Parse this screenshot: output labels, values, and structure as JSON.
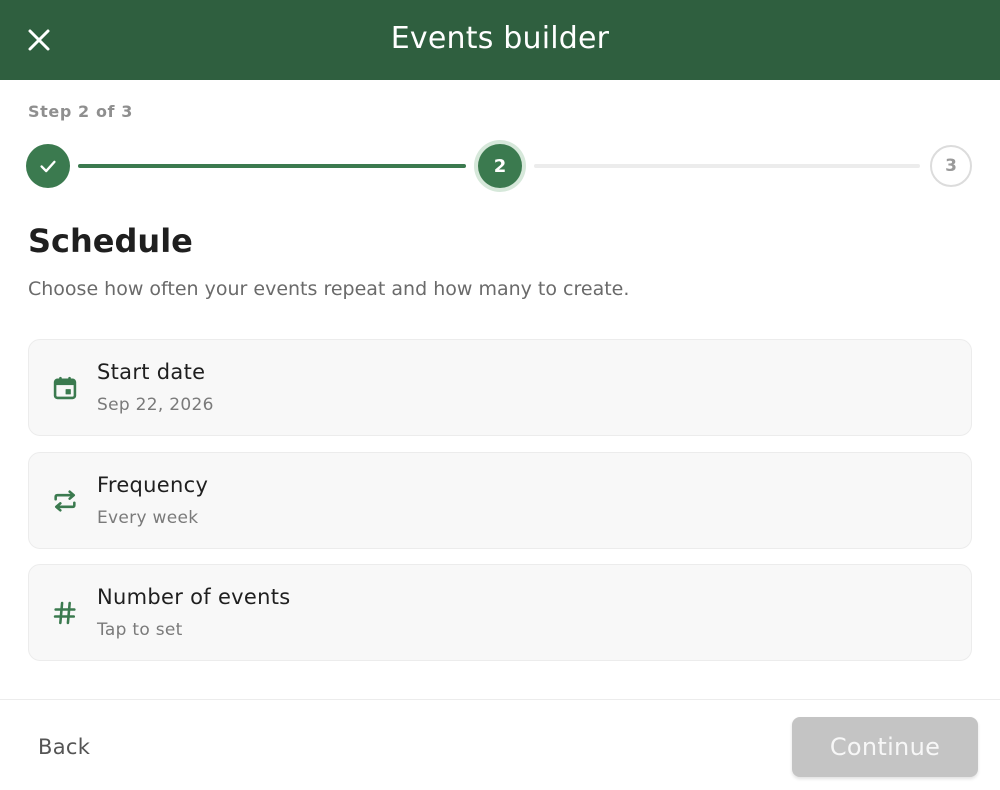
{
  "header": {
    "title": "Events builder",
    "close_icon": "close-icon",
    "background_color": "#2f5f3f"
  },
  "stepper": {
    "label": "Step 2 of 3",
    "current_step": 2,
    "total_steps": 3,
    "steps": [
      {
        "label": "",
        "state": "done",
        "icon": "check-icon"
      },
      {
        "label": "2",
        "state": "current"
      },
      {
        "label": "3",
        "state": "todo"
      }
    ],
    "accent_color": "#3b7a4f"
  },
  "section": {
    "title": "Schedule",
    "description": "Choose how often your events repeat and how many to create."
  },
  "options": [
    {
      "title": "Start date",
      "value": "Sep 22, 2026",
      "icon": "calendar-icon"
    },
    {
      "title": "Frequency",
      "value": "Every week",
      "icon": "repeat-icon"
    },
    {
      "title": "Number of events",
      "value": "Tap to set",
      "icon": "hash-icon"
    }
  ],
  "footer": {
    "back_label": "Back",
    "continue_label": "Continue",
    "continue_state": "disabled"
  }
}
